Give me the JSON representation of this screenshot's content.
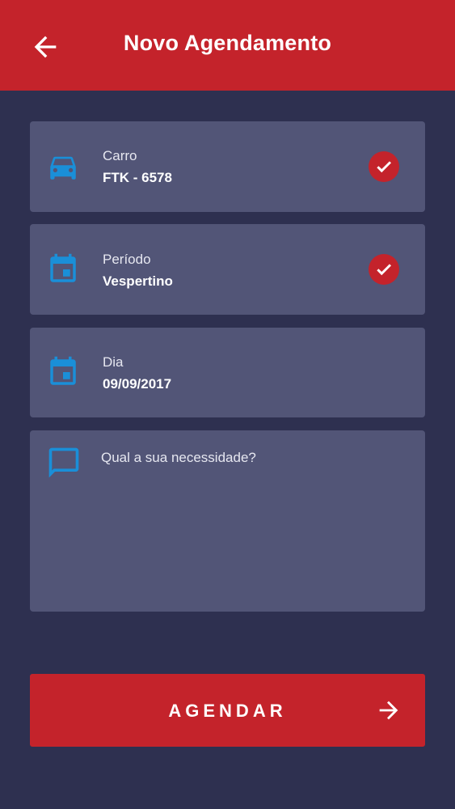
{
  "app_bar": {
    "title": "Novo Agendamento",
    "back_icon": "arrow-back-icon",
    "color": "#c4232b"
  },
  "fields": {
    "car": {
      "label": "Carro",
      "value": "FTK - 6578",
      "icon": "car-icon",
      "checked": true
    },
    "period": {
      "label": "Período",
      "value": "Vespertino",
      "icon": "calendar-icon",
      "checked": true
    },
    "day": {
      "label": "Dia",
      "value": "09/09/2017",
      "icon": "calendar-icon",
      "checked": false
    }
  },
  "need": {
    "placeholder": "Qual a sua necessidade?",
    "value": "",
    "icon": "message-icon"
  },
  "submit": {
    "label": "AGENDAR",
    "icon": "arrow-forward-icon"
  },
  "colors": {
    "background": "#2e3050",
    "card": "#525577",
    "accent": "#c4232b",
    "icon_blue": "#1a8fd8"
  }
}
